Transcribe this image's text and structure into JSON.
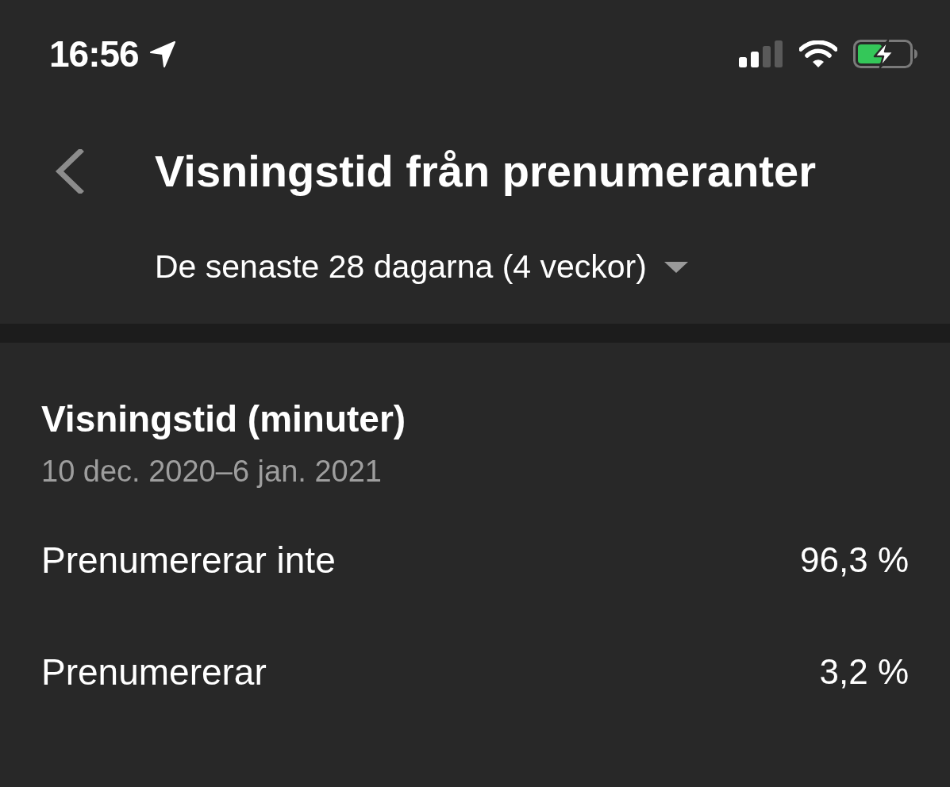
{
  "status_bar": {
    "time": "16:56"
  },
  "header": {
    "title": "Visningstid från prenumeranter",
    "period": "De senaste 28 dagarna (4 veckor)"
  },
  "card": {
    "title": "Visningstid (minuter)",
    "date_range": "10 dec. 2020–6 jan. 2021",
    "rows": [
      {
        "label": "Prenumererar inte",
        "value": "96,3 %"
      },
      {
        "label": "Prenumererar",
        "value": "3,2 %"
      }
    ]
  }
}
